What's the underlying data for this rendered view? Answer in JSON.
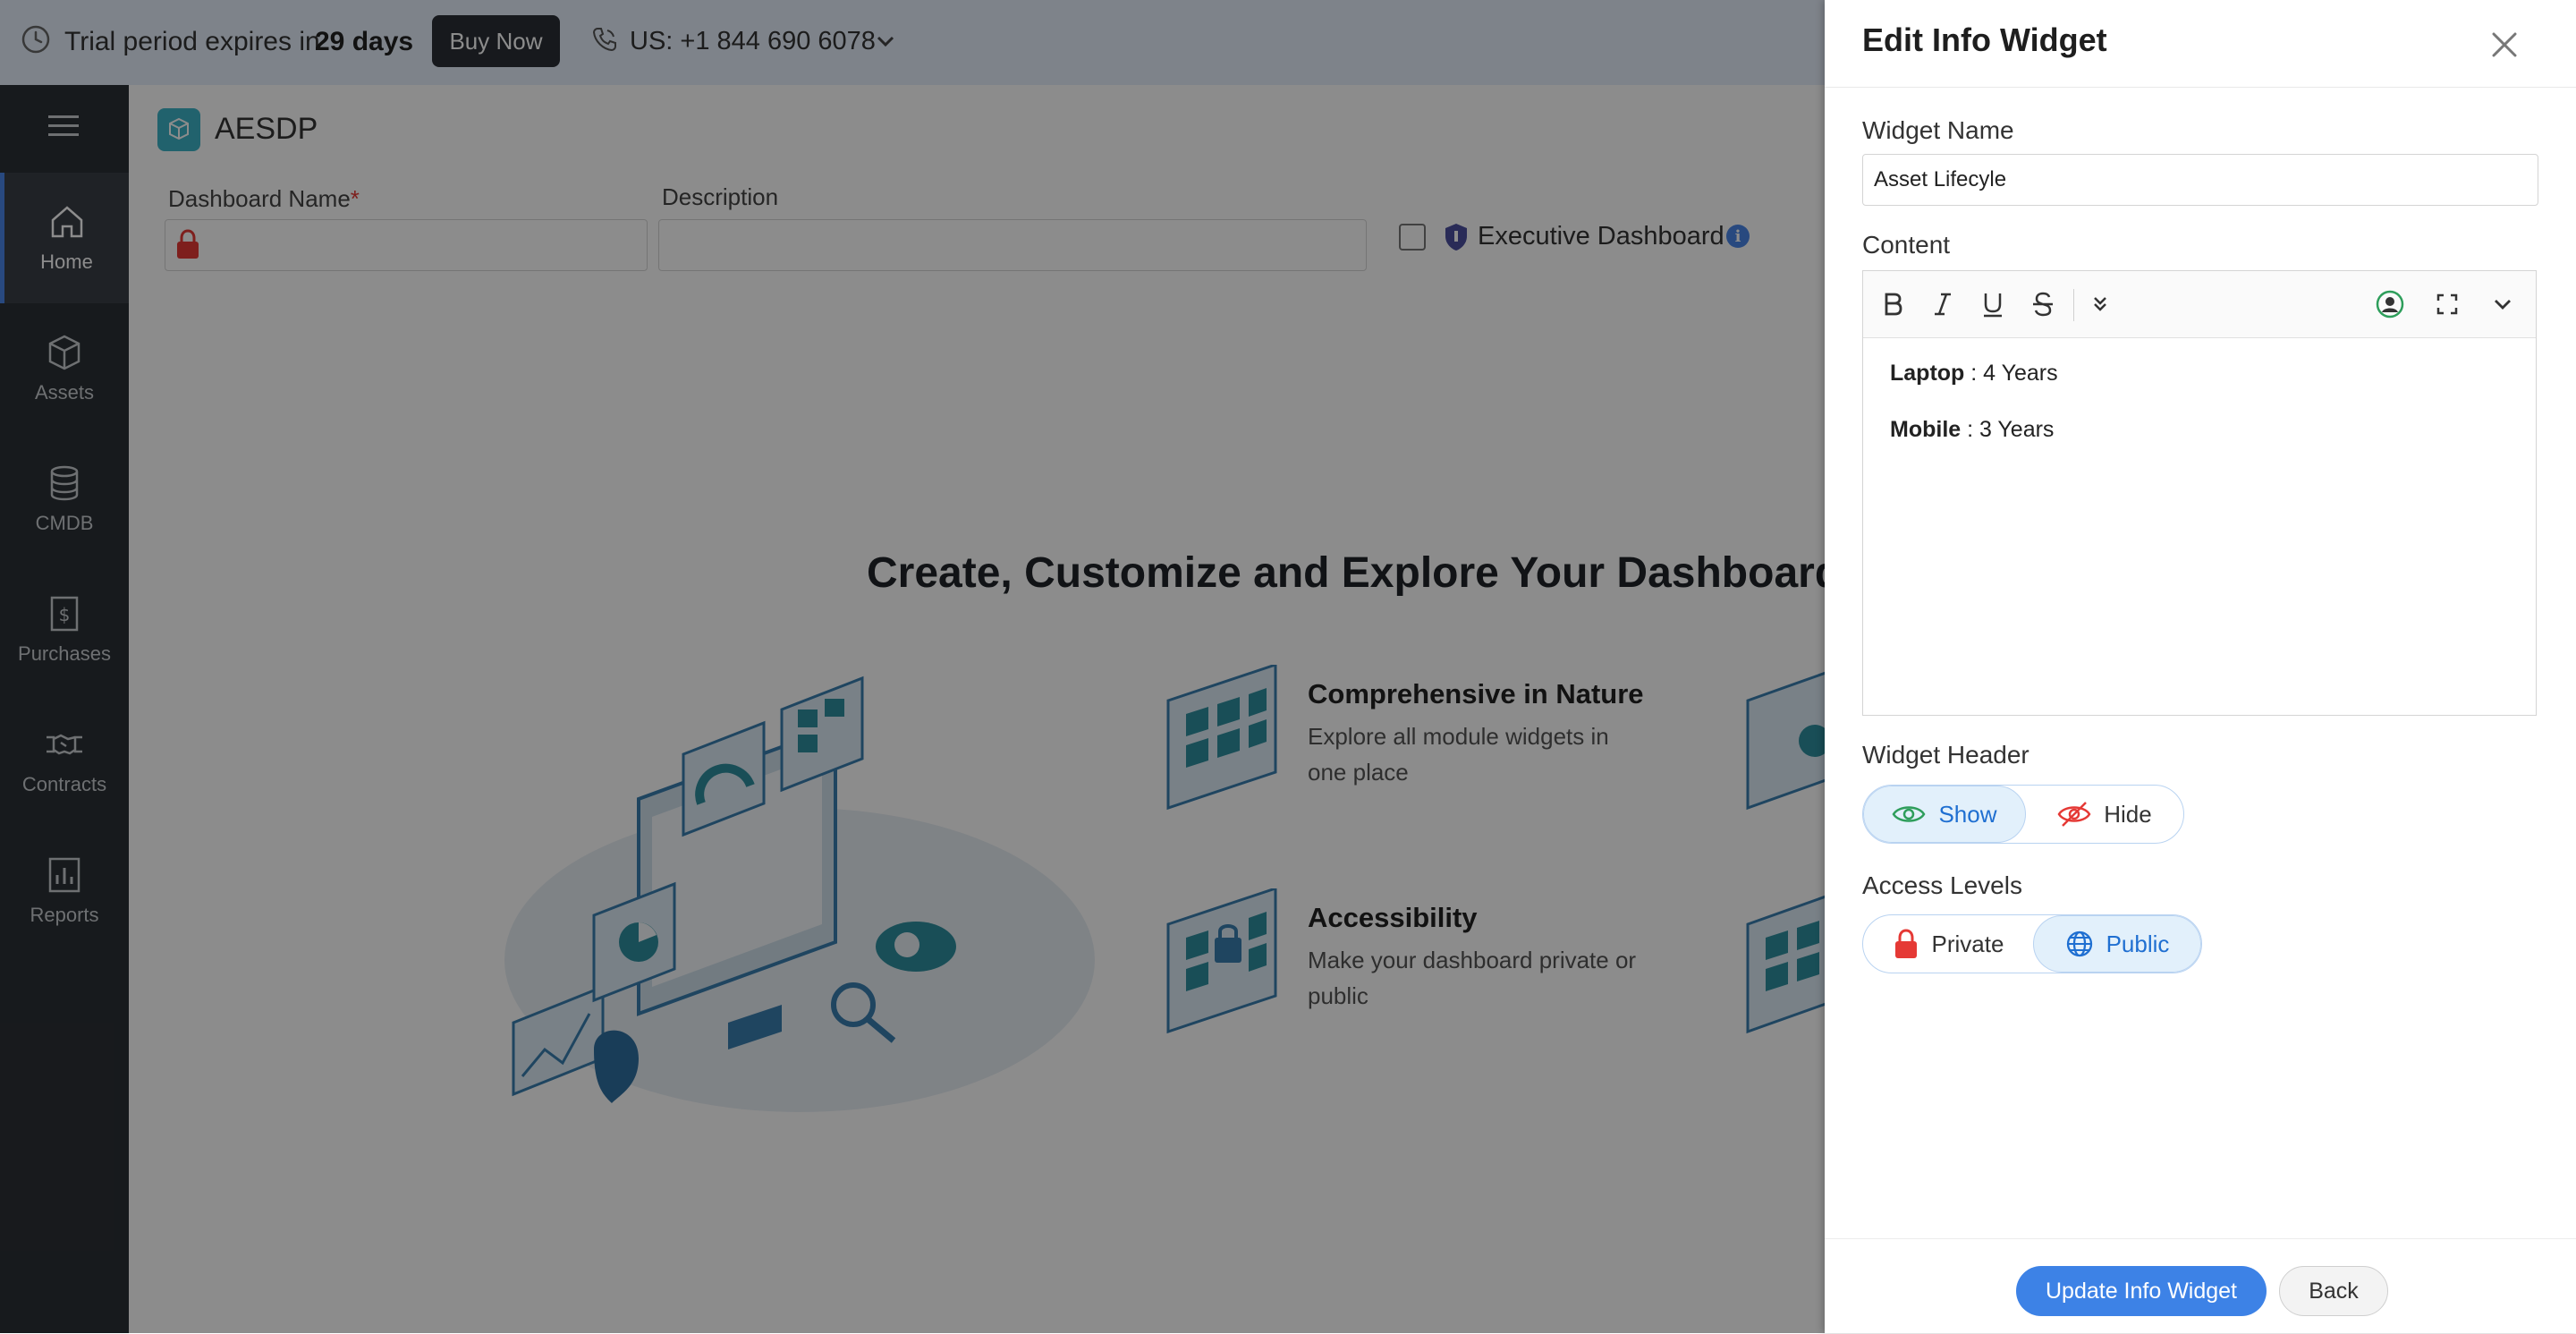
{
  "trial": {
    "prefix": "Trial period expires in",
    "days": "29 days",
    "buy_now": "Buy Now",
    "phone": "US: +1 844 690 6078"
  },
  "sidebar": {
    "items": [
      {
        "label": "Home",
        "icon": "home-icon"
      },
      {
        "label": "Assets",
        "icon": "cube-icon"
      },
      {
        "label": "CMDB",
        "icon": "database-icon"
      },
      {
        "label": "Purchases",
        "icon": "dollar-receipt-icon"
      },
      {
        "label": "Contracts",
        "icon": "handshake-icon"
      },
      {
        "label": "Reports",
        "icon": "bar-chart-icon"
      }
    ]
  },
  "header": {
    "app_name": "AESDP"
  },
  "form": {
    "dashboard_name_label": "Dashboard Name",
    "required_mark": "*",
    "description_label": "Description",
    "executive_label": "Executive Dashboard"
  },
  "hero": {
    "title": "Create, Customize and Explore Your Dashboard",
    "features": [
      {
        "title": "Comprehensive in Nature",
        "desc": "Explore all module widgets in one place"
      },
      {
        "title": "Accessibility",
        "desc": "Make your dashboard private or public"
      }
    ]
  },
  "panel": {
    "title": "Edit Info Widget",
    "widget_name_label": "Widget Name",
    "widget_name_value": "Asset Lifecyle",
    "content_label": "Content",
    "content_lines": [
      {
        "key": "Laptop",
        "value": " : 4 Years"
      },
      {
        "key": "Mobile",
        "value": " : 3 Years"
      }
    ],
    "widget_header_label": "Widget Header",
    "header_options": {
      "show": "Show",
      "hide": "Hide",
      "selected": "Show"
    },
    "access_levels_label": "Access Levels",
    "access_options": {
      "private": "Private",
      "public": "Public",
      "selected": "Public"
    },
    "update_button": "Update Info Widget",
    "back_button": "Back"
  },
  "colors": {
    "accent": "#3d82e6",
    "sidebar_bg": "#2b3035",
    "selected_option_bg": "#e2f0fb",
    "lock_red": "#e53935",
    "show_green": "#2e9e5b"
  }
}
